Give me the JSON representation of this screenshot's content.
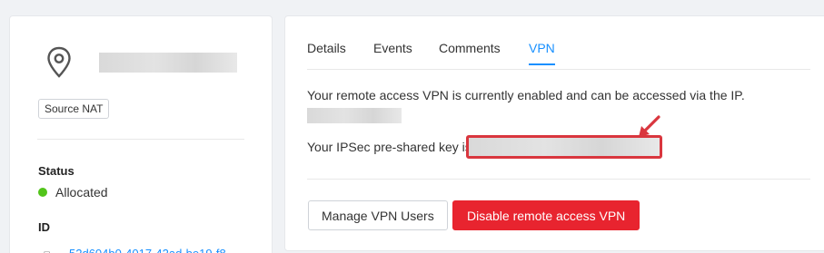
{
  "left_panel": {
    "tag_label": "Source NAT",
    "status_title": "Status",
    "status_value": "Allocated",
    "id_title": "ID",
    "id_value": "52d604b0-4017-42ad-be19-f8"
  },
  "tabs": [
    {
      "label": "Details",
      "active": false
    },
    {
      "label": "Events",
      "active": false
    },
    {
      "label": "Comments",
      "active": false
    },
    {
      "label": "VPN",
      "active": true
    }
  ],
  "vpn": {
    "enabled_message": "Your remote access VPN is currently enabled and can be accessed via the IP.",
    "psk_message": "Your IPSec pre-shared key is"
  },
  "buttons": {
    "manage_users": "Manage VPN Users",
    "disable_vpn": "Disable remote access VPN"
  },
  "colors": {
    "accent": "#1890ff",
    "danger": "#e8242f",
    "status_ok": "#52c41a",
    "annotation": "#d9363e"
  },
  "icons": [
    "location-pin-icon",
    "copy-icon",
    "annotation-arrow-icon"
  ]
}
